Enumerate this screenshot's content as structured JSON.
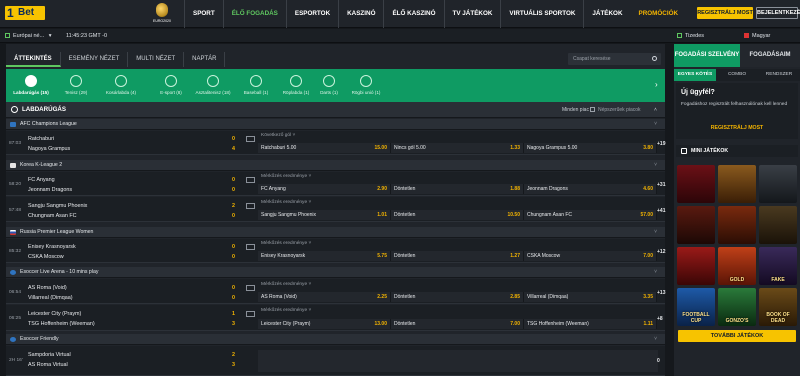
{
  "header": {
    "logo_one": "1",
    "logo_bet": "Bet",
    "euro_label": "EURO2020",
    "nav": [
      "SPORT",
      "ÉLŐ FOGADÁS",
      "ESPORTOK",
      "KASZINÓ",
      "ÉLŐ KASZINÓ",
      "TV JÁTÉKOK",
      "VIRTUÁLIS SPORTOK",
      "JÁTÉKOK"
    ],
    "promo": "PROMÓCIÓK",
    "register": "REGISZTRÁLJ MOST",
    "login": "BEJELENTKEZÉS",
    "accent": "#5fc760",
    "brand_yellow": "#f7c300"
  },
  "subbar": {
    "region": "Európai né...",
    "region_arrow": "▾",
    "clock": "11:45:23 GMT -0",
    "odds_format": "Tizedes",
    "language": "Magyar"
  },
  "tabs": [
    "ÁTTEKINTÉS",
    "ESEMÉNY NÉZET",
    "MULTI NÉZET",
    "NAPTÁR"
  ],
  "search_placeholder": "Csapat keresése",
  "sports": [
    {
      "label": "Labdarúgás (15)",
      "icon": "football-icon"
    },
    {
      "label": "Tenisz (29)",
      "icon": "tennis-icon"
    },
    {
      "label": "Kosárlabda (4)",
      "icon": "basketball-icon"
    },
    {
      "label": "E-sport (8)",
      "icon": "esport-icon"
    },
    {
      "label": "Asztalitenisz (18)",
      "icon": "table-tennis-icon"
    },
    {
      "label": "Baseball (1)",
      "icon": "baseball-icon"
    },
    {
      "label": "Röplabda (1)",
      "icon": "volleyball-icon"
    },
    {
      "label": "Darts (1)",
      "icon": "darts-icon"
    },
    {
      "label": "Rögbi unió (1)",
      "icon": "rugby-icon"
    }
  ],
  "section": {
    "title": "LABDARÚGÁS",
    "market_filter": "Minden piac",
    "market_select": "Népszerűek piacok"
  },
  "leagues": [
    {
      "name": "AFC Champions League",
      "matches": [
        {
          "time": "87:03",
          "home": "Ratchaburi",
          "away": "Nagoya Grampus",
          "score_home": "0",
          "score_away": "4",
          "market": "Következő gól",
          "odds": [
            {
              "name": "Ratchaburi 5.00",
              "value": "15.00"
            },
            {
              "name": "Nincs gól 5.00",
              "value": "1.33"
            },
            {
              "name": "Nagoya Grampus 5.00",
              "value": "3.80"
            }
          ],
          "more": "+19"
        }
      ]
    },
    {
      "name": "Korea K-League 2",
      "matches": [
        {
          "time": "58:20",
          "home": "FC Anyang",
          "away": "Jeonnam Dragons",
          "score_home": "0",
          "score_away": "0",
          "market": "Mérkőzés eredménye",
          "odds": [
            {
              "name": "FC Anyang",
              "value": "2.90"
            },
            {
              "name": "Döntetlen",
              "value": "1.88"
            },
            {
              "name": "Jeonnam Dragons",
              "value": "4.60"
            }
          ],
          "more": "+31"
        },
        {
          "time": "57:48",
          "home": "Sangju Sangmu Phoenix",
          "away": "Chungnam Asan FC",
          "score_home": "2",
          "score_away": "0",
          "market": "Mérkőzés eredménye",
          "odds": [
            {
              "name": "Sangju Sangmu Phoenix",
              "value": "1.01"
            },
            {
              "name": "Döntetlen",
              "value": "10.50"
            },
            {
              "name": "Chungnam Asan FC",
              "value": "57.00"
            }
          ],
          "more": "+41"
        }
      ]
    },
    {
      "name": "Russia Premier League Women",
      "matches": [
        {
          "time": "85:32",
          "home": "Enisey Krasnoyarsk",
          "away": "CSKA Moscow",
          "score_home": "0",
          "score_away": "0",
          "market": "Mérkőzés eredménye",
          "odds": [
            {
              "name": "Enisey Krasnoyarsk",
              "value": "5.75"
            },
            {
              "name": "Döntetlen",
              "value": "1.27"
            },
            {
              "name": "CSKA Moscow",
              "value": "7.00"
            }
          ],
          "more": "+12"
        }
      ]
    },
    {
      "name": "Esoccer Live Arena - 10 mins play",
      "matches": [
        {
          "time": "06:54",
          "home": "AS Roma (Void)",
          "away": "Villarreal (Dimqaa)",
          "score_home": "0",
          "score_away": "0",
          "market": "Mérkőzés eredménye",
          "odds": [
            {
              "name": "AS Roma (Void)",
              "value": "2.25"
            },
            {
              "name": "Döntetlen",
              "value": "2.85"
            },
            {
              "name": "Villarreal (Dimqaa)",
              "value": "3.35"
            }
          ],
          "more": "+13"
        },
        {
          "time": "06:25",
          "home": "Leicester City (Praym)",
          "away": "TSG Hoffenheim (Weeman)",
          "score_home": "1",
          "score_away": "3",
          "market": "Mérkőzés eredménye",
          "odds": [
            {
              "name": "Leicester City (Praym)",
              "value": "13.00"
            },
            {
              "name": "Döntetlen",
              "value": "7.00"
            },
            {
              "name": "TSG Hoffenheim (Weeman)",
              "value": "1.11"
            }
          ],
          "more": "+8"
        }
      ]
    },
    {
      "name": "Esoccer Friendly",
      "matches": [
        {
          "time": "2H 16'",
          "home": "Sampdoria Virtual",
          "away": "AS Roma Virtual",
          "score_home": "2",
          "score_away": "3",
          "market": "",
          "odds": [],
          "more": "0"
        }
      ]
    }
  ],
  "right": {
    "tab_active": "FOGADÁSI SZELVÉNY",
    "tab_other": "FOGADÁSAIM",
    "subtabs": [
      "EGYES KÖTÉS",
      "COMBO",
      "RENDSZER"
    ],
    "new_client_title": "Új ügyfél?",
    "new_client_text": "Fogadáshoz regisztrált felhasználónak kell lenned",
    "register_link": "REGISZTRÁLJ MOST",
    "mini_games_title": "MINI JÁTÉKOK",
    "games": [
      "",
      "",
      "",
      "",
      "",
      "",
      "",
      "GOLD",
      "FAKE",
      "FOOTBALL CUP",
      "GONZO'S",
      "BOOK OF DEAD"
    ],
    "more_games": "TOVÁBBI JÁTÉKOK"
  }
}
